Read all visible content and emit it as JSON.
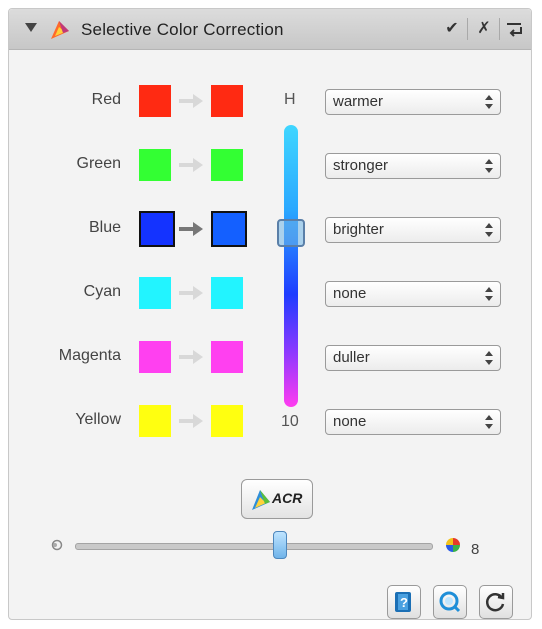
{
  "panel": {
    "title": "Selective Color Correction",
    "titlebar_buttons": [
      "apply-check",
      "close-x",
      "menu"
    ]
  },
  "rows": [
    {
      "label": "Red",
      "from_color": "#ff2a12",
      "to_color": "#ff2a12",
      "option": "warmer",
      "selected": false
    },
    {
      "label": "Green",
      "from_color": "#33ff33",
      "to_color": "#33ff33",
      "option": "stronger",
      "selected": false
    },
    {
      "label": "Blue",
      "from_color": "#1433ff",
      "to_color": "#1460ff",
      "option": "brighter",
      "selected": true
    },
    {
      "label": "Cyan",
      "from_color": "#22f4ff",
      "to_color": "#22f4ff",
      "option": "none",
      "selected": false
    },
    {
      "label": "Magenta",
      "from_color": "#ff40f0",
      "to_color": "#ff40f0",
      "option": "duller",
      "selected": false
    },
    {
      "label": "Yellow",
      "from_color": "#ffff10",
      "to_color": "#ffff10",
      "option": "none",
      "selected": false
    }
  ],
  "vertical_slider": {
    "top_label": "H",
    "bottom_label": "10"
  },
  "acr_button": {
    "label": "ACR"
  },
  "bottom_slider": {
    "value_label": "8"
  },
  "footer_buttons": [
    "help-icon",
    "zoom-icon",
    "reset-icon"
  ]
}
